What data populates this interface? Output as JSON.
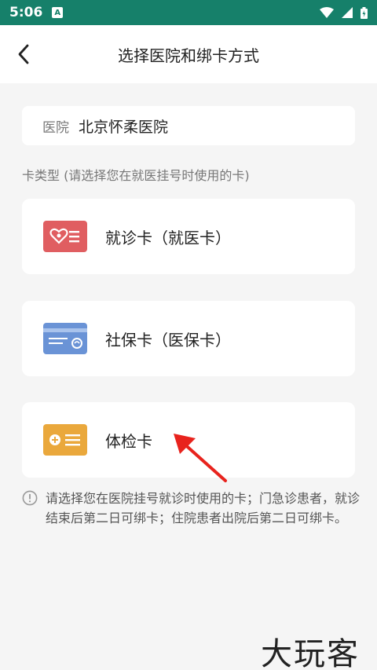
{
  "status_bar": {
    "time": "5:06",
    "app_badge": "A"
  },
  "nav": {
    "title": "选择医院和绑卡方式"
  },
  "hospital": {
    "label": "医院",
    "value": "北京怀柔医院"
  },
  "section_hint": "卡类型 (请选择您在就医挂号时使用的卡)",
  "cards": [
    {
      "label": "就诊卡（就医卡）",
      "icon": "medical-card-icon",
      "color": "#e05e61"
    },
    {
      "label": "社保卡（医保卡）",
      "icon": "social-security-card-icon",
      "color": "#6a93d6"
    },
    {
      "label": "体检卡",
      "icon": "exam-card-icon",
      "color": "#eaa83c"
    }
  ],
  "notice": "请选择您在医院挂号就诊时使用的卡；门急诊患者，就诊结束后第二日可绑卡；住院患者出院后第二日可绑卡。",
  "watermark": "大玩客"
}
